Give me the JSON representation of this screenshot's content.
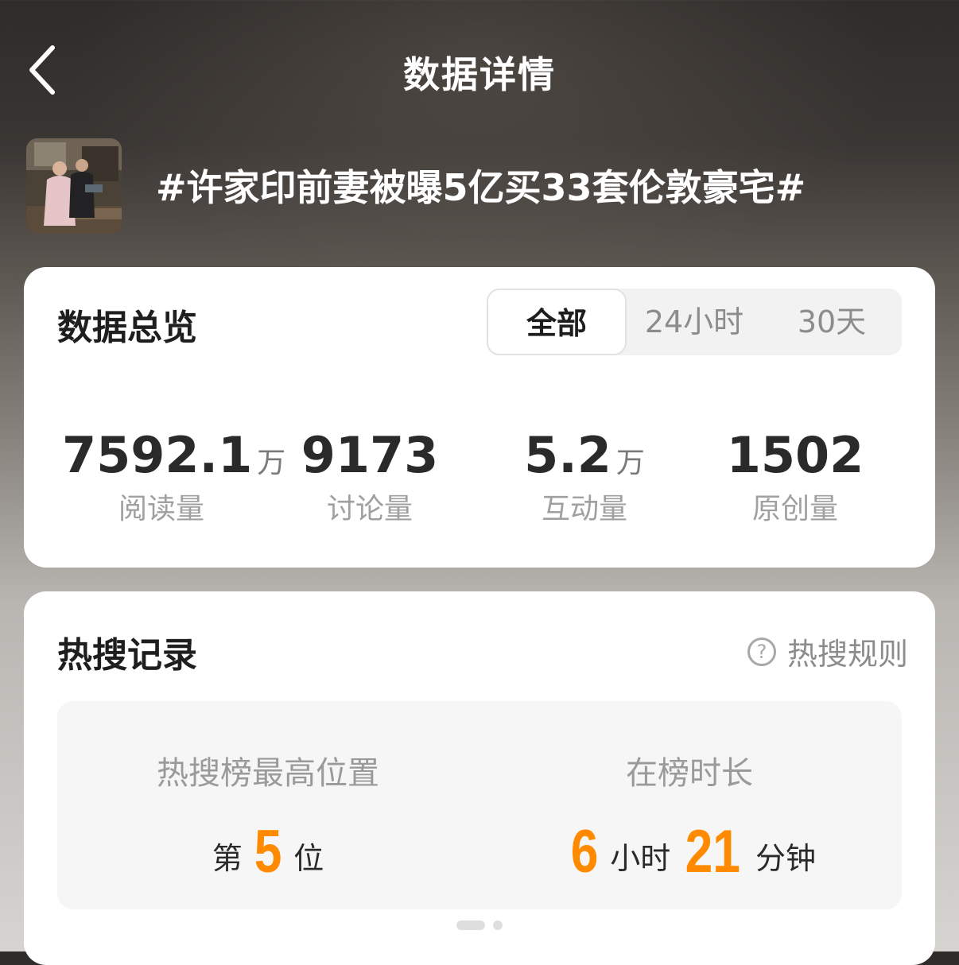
{
  "header": {
    "title": "数据详情",
    "back_icon": "chevron-left-icon"
  },
  "topic": {
    "title": "#许家印前妻被曝5亿买33套伦敦豪宅#"
  },
  "overview": {
    "heading": "数据总览",
    "tabs": [
      {
        "label": "全部",
        "active": true
      },
      {
        "label": "24小时",
        "active": false
      },
      {
        "label": "30天",
        "active": false
      }
    ],
    "stats": [
      {
        "value": "7592.1",
        "unit": "万",
        "label": "阅读量"
      },
      {
        "value": "9173",
        "unit": "",
        "label": "讨论量"
      },
      {
        "value": "5.2",
        "unit": "万",
        "label": "互动量"
      },
      {
        "value": "1502",
        "unit": "",
        "label": "原创量"
      }
    ]
  },
  "hot_search": {
    "heading": "热搜记录",
    "rule_label": "热搜规则",
    "rule_icon": "question-circle-icon",
    "highest_label": "热搜榜最高位置",
    "highest_prefix": "第",
    "highest_value": "5",
    "highest_suffix": "位",
    "duration_label": "在榜时长",
    "duration_hours": "6",
    "duration_hours_unit": "小时",
    "duration_minutes": "21",
    "duration_minutes_unit": "分钟",
    "page_indicator": {
      "count": 2,
      "active": 0
    }
  },
  "colors": {
    "accent_orange": "#ff8a00",
    "card_bg": "#ffffff",
    "text_primary": "#1e1e1e",
    "text_secondary": "#a0a0a0"
  }
}
